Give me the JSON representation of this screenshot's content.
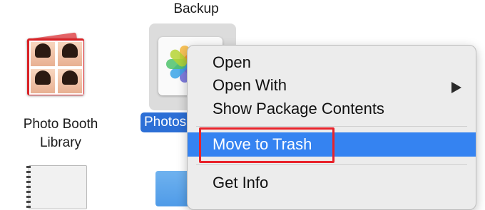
{
  "desktop": {
    "backup_label": "Backup",
    "photobooth_label": "Photo Booth\nLibrary",
    "photos_selected_label": "Photos"
  },
  "context_menu": {
    "items": [
      {
        "label": "Open"
      },
      {
        "label": "Open With",
        "submenu": true
      },
      {
        "label": "Show Package Contents"
      },
      {
        "label": "Move to Trash",
        "highlighted": true
      },
      {
        "label": "Get Info"
      }
    ]
  },
  "colors": {
    "selection": "#3583f1",
    "annotation": "#e8232b"
  }
}
